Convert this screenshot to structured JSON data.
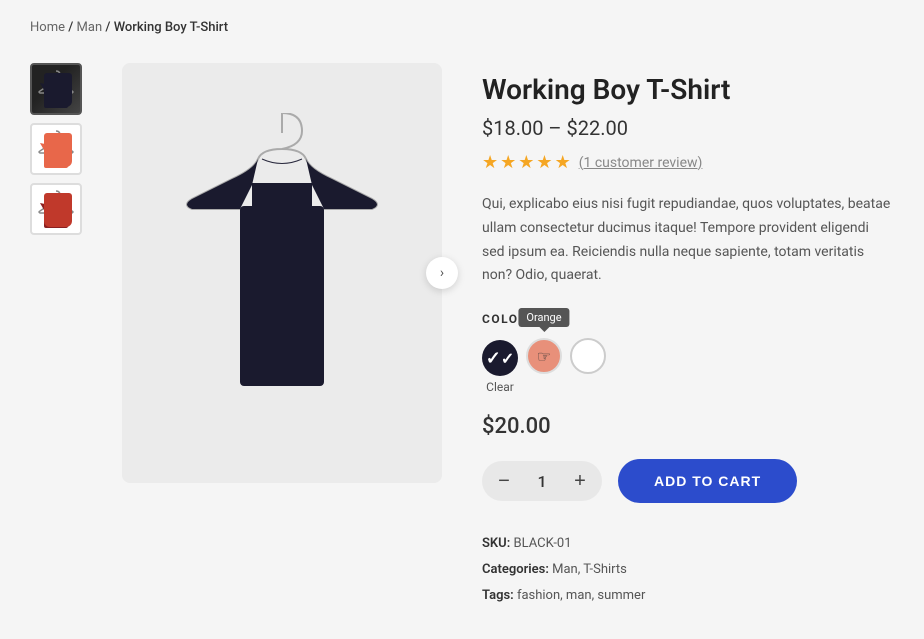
{
  "breadcrumb": {
    "home": "Home",
    "separator1": "/",
    "man": "Man",
    "separator2": "/",
    "product": "Working Boy T-Shirt"
  },
  "product": {
    "title": "Working Boy T-Shirt",
    "price_range": "$18.00 – $22.00",
    "review_count": "(1 customer review)",
    "description": "Qui, explicabo eius nisi fugit repudiandae, quos voluptates, beatae ullam consectetur ducimus itaque! Tempore provident eligendi sed ipsum ea. Reiciendis nulla neque sapiente, totam veritatis non? Odio, quaerat.",
    "color_label": "COLOR",
    "colors": [
      {
        "name": "black",
        "label": "Clear",
        "selected": true
      },
      {
        "name": "orange",
        "tooltip": "Orange",
        "selected": false
      },
      {
        "name": "white",
        "label": "",
        "selected": false
      }
    ],
    "selected_price": "$20.00",
    "quantity": 1,
    "quantity_minus": "−",
    "quantity_plus": "+",
    "add_to_cart": "ADD TO CART",
    "sku_label": "SKU:",
    "sku_value": "BLACK-01",
    "categories_label": "Categories:",
    "categories_value": "Man, T-Shirts",
    "tags_label": "Tags:",
    "tags_value": "fashion, man, summer"
  },
  "thumbnails": [
    {
      "alt": "Black T-Shirt thumbnail",
      "color": "black",
      "active": true
    },
    {
      "alt": "Orange T-Shirt thumbnail",
      "color": "orange",
      "active": false
    },
    {
      "alt": "Red T-Shirt thumbnail",
      "color": "red",
      "active": false
    }
  ],
  "stars": 5
}
